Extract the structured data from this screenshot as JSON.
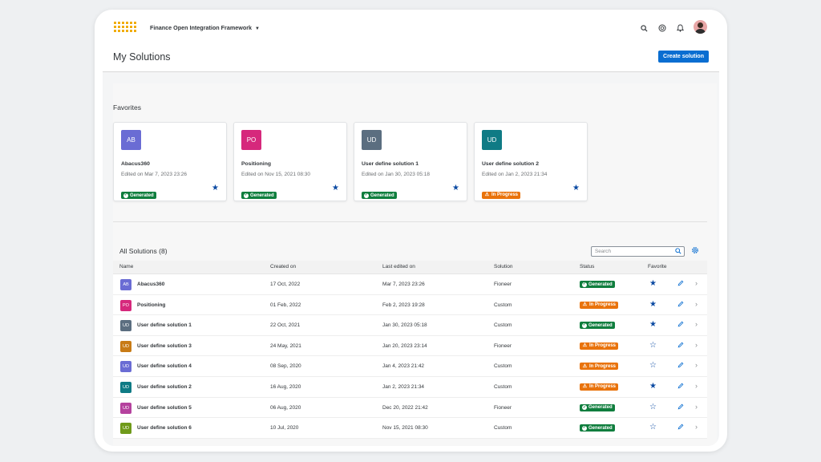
{
  "colors": {
    "accent": "#0a6ed1",
    "generated": "#107e3e",
    "in_progress": "#e9730c",
    "favorite_star": "#0b4aa2",
    "logo": "#f0ab00"
  },
  "header": {
    "app_title": "Finance Open Integration Framework",
    "icons": [
      "search-icon",
      "copilot-icon",
      "bell-icon",
      "user-avatar"
    ]
  },
  "page": {
    "title": "My Solutions",
    "create_button": "Create solution"
  },
  "favorites": {
    "title": "Favorites",
    "cards": [
      {
        "initials": "AB",
        "name": "Abacus360",
        "edited": "Edited on Mar 7, 2023 23:26",
        "status": "Generated",
        "tile_color": "#6a6cd4"
      },
      {
        "initials": "PO",
        "name": "Positioning",
        "edited": "Edited on Nov 15, 2021 08:30",
        "status": "Generated",
        "tile_color": "#d6287c"
      },
      {
        "initials": "UD",
        "name": "User define solution 1",
        "edited": "Edited on Jan 30, 2023 05:18",
        "status": "Generated",
        "tile_color": "#5b6e80"
      },
      {
        "initials": "UD",
        "name": "User define solution 2",
        "edited": "Edited on Jan 2, 2023 21:34",
        "status": "In Progress",
        "tile_color": "#0f7b85"
      }
    ]
  },
  "all_solutions": {
    "title": "All Solutions (8)",
    "search_placeholder": "Search",
    "columns": [
      "Name",
      "Created on",
      "Last edited on",
      "Solution",
      "Status",
      "Favorite"
    ],
    "rows": [
      {
        "initials": "AB",
        "name": "Abacus360",
        "created": "17 Oct, 2022",
        "last_edited": "Mar 7, 2023 23:26",
        "solution": "Fioneer",
        "status": "Generated",
        "favorite": true,
        "tile_color": "#6a6cd4"
      },
      {
        "initials": "PO",
        "name": "Positioning",
        "created": "01 Feb, 2022",
        "last_edited": "Feb 2, 2023 19:28",
        "solution": "Custom",
        "status": "In Progress",
        "favorite": true,
        "tile_color": "#d6287c"
      },
      {
        "initials": "UD",
        "name": "User define solution 1",
        "created": "22 Oct, 2021",
        "last_edited": "Jan 30, 2023 05:18",
        "solution": "Custom",
        "status": "Generated",
        "favorite": true,
        "tile_color": "#5b6e80"
      },
      {
        "initials": "UD",
        "name": "User define solution 3",
        "created": "24 May, 2021",
        "last_edited": "Jan 20, 2023 23:14",
        "solution": "Fioneer",
        "status": "In Progress",
        "favorite": false,
        "tile_color": "#c87b16"
      },
      {
        "initials": "UD",
        "name": "User define solution 4",
        "created": "08 Sep, 2020",
        "last_edited": "Jan 4, 2023 21:42",
        "solution": "Custom",
        "status": "In Progress",
        "favorite": false,
        "tile_color": "#6a6cd4"
      },
      {
        "initials": "UD",
        "name": "User define solution 2",
        "created": "16 Aug, 2020",
        "last_edited": "Jan 2, 2023 21:34",
        "solution": "Custom",
        "status": "In Progress",
        "favorite": true,
        "tile_color": "#0f7b85"
      },
      {
        "initials": "UD",
        "name": "User define solution 5",
        "created": "06 Aug, 2020",
        "last_edited": "Dec 20, 2022 21:42",
        "solution": "Fioneer",
        "status": "Generated",
        "favorite": false,
        "tile_color": "#b5429e"
      },
      {
        "initials": "UD",
        "name": "User define solution 6",
        "created": "10 Jul, 2020",
        "last_edited": "Nov 15, 2021 08:30",
        "solution": "Custom",
        "status": "Generated",
        "favorite": false,
        "tile_color": "#6f9a1a"
      }
    ]
  }
}
